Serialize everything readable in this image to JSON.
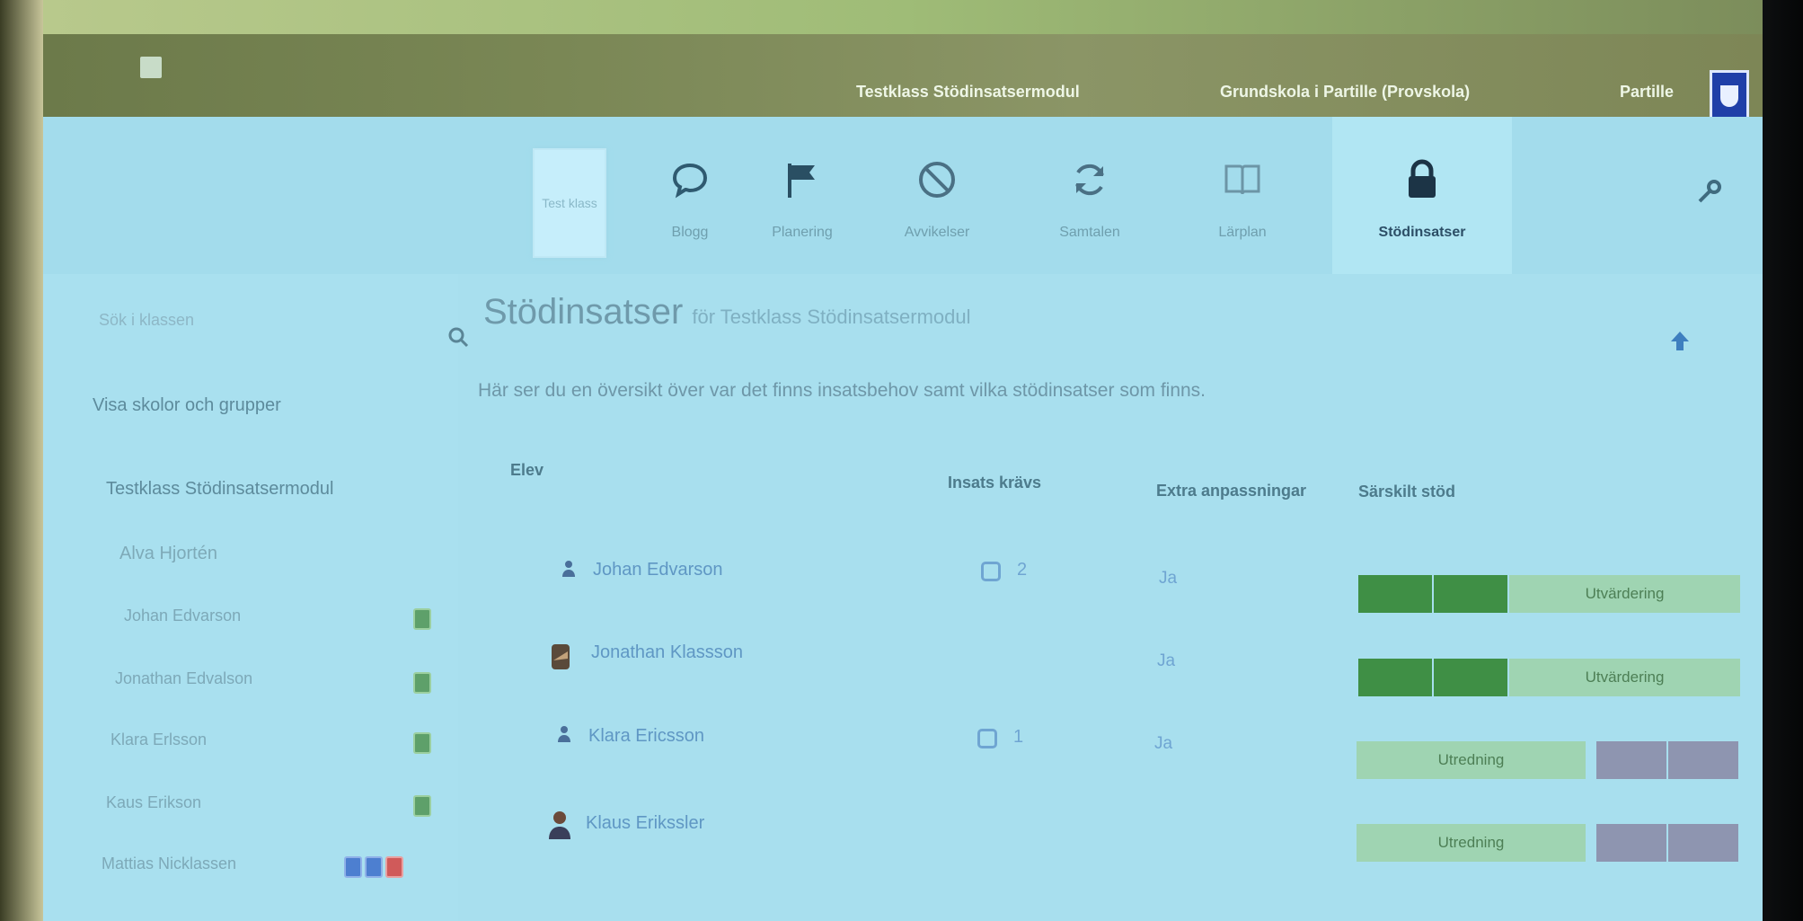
{
  "header": {
    "links": [
      "Testklass Stödinsatsermodul",
      "Grundskola i Partille (Provskola)",
      "Partille"
    ]
  },
  "toolbar": {
    "tile_label": "Test klass",
    "tools": [
      {
        "label": "Blogg",
        "icon": "speech-bubble-icon"
      },
      {
        "label": "Planering",
        "icon": "flag-icon"
      },
      {
        "label": "Avvikelser",
        "icon": "no-entry-icon"
      },
      {
        "label": "Samtalen",
        "icon": "refresh-icon"
      },
      {
        "label": "Lärplan",
        "icon": "book-icon"
      },
      {
        "label": "Stödinsatser",
        "icon": "lock-icon",
        "active": true
      }
    ]
  },
  "sidebar": {
    "search_placeholder": "Sök i klassen",
    "items": [
      "Visa skolor och grupper",
      "Testklass Stödinsatsermodul",
      "Alva Hjortén"
    ],
    "students": [
      {
        "name": "Johan Edvarson",
        "badges": [
          "#5ea06a"
        ]
      },
      {
        "name": "Jonathan Edvalson",
        "badges": [
          "#5ea06a"
        ]
      },
      {
        "name": "Klara Erlsson",
        "badges": [
          "#5ea06a"
        ]
      },
      {
        "name": "Kaus Erikson",
        "badges": [
          "#5ea06a"
        ]
      },
      {
        "name": "Mattias Nicklassen",
        "badges": [
          "#4d7fd0",
          "#4d7fd0",
          "#d05a5a"
        ]
      }
    ]
  },
  "main": {
    "title": "Stödinsatser",
    "subtitle": "för Testklass Stödinsatsermodul",
    "description": "Här ser du en översikt över var det finns insatsbehov samt vilka stödinsatser som finns.",
    "columns": [
      "Elev",
      "Insats krävs",
      "Extra anpassningar",
      "Särskilt stöd"
    ],
    "rows": [
      {
        "name": "Johan Edvarson",
        "count": "2",
        "extra": "Ja",
        "status": "Utvärdering",
        "layout": "green"
      },
      {
        "name": "Jonathan Klassson",
        "count": "",
        "extra": "Ja",
        "status": "Utvärdering",
        "layout": "green"
      },
      {
        "name": "Klara Ericsson",
        "count": "1",
        "extra": "Ja",
        "status": "Utredning",
        "layout": "gray"
      },
      {
        "name": "Klaus Erikssler",
        "count": "",
        "extra": "",
        "status": "Utredning",
        "layout": "gray"
      }
    ]
  },
  "colors": {
    "header_bg": "#7a8755",
    "content_bg": "#a8dfee",
    "progress_green": "#3f8f45",
    "progress_light": "#9fd4b2",
    "progress_gray": "#8e95b0",
    "link_blue": "#5f97c4"
  }
}
